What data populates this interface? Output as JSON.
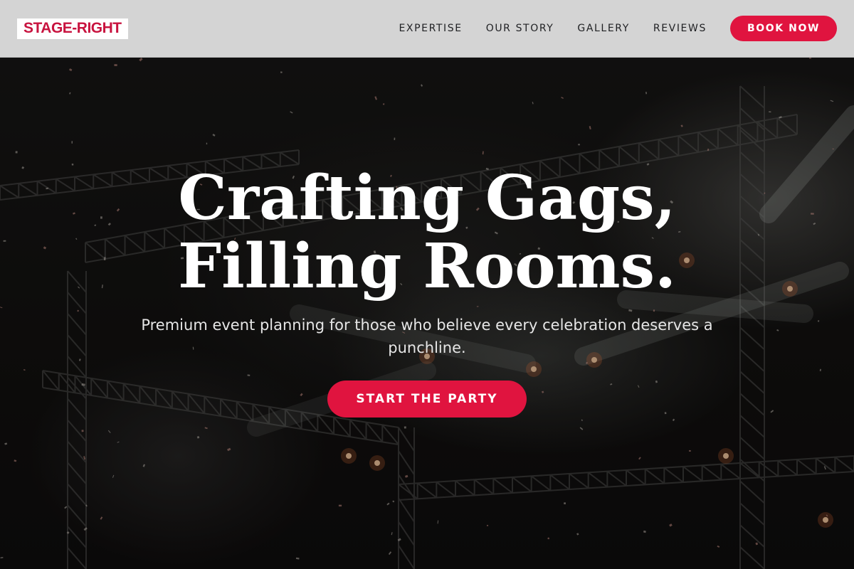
{
  "brand": {
    "logo_text": "STAGE-RIGHT",
    "accent_color": "#e0143f",
    "logo_color": "#c8133f"
  },
  "nav": {
    "items": [
      {
        "label": "EXPERTISE"
      },
      {
        "label": "OUR STORY"
      },
      {
        "label": "GALLERY"
      },
      {
        "label": "REVIEWS"
      }
    ],
    "cta_label": "BOOK NOW"
  },
  "hero": {
    "title_line1": "Crafting Gags,",
    "title_line2": "Filling Rooms.",
    "subtitle": "Premium event planning for those who believe every celebration deserves a punchline.",
    "cta_label": "START THE PARTY",
    "background": "concert-stage-truss-lights-photo"
  }
}
